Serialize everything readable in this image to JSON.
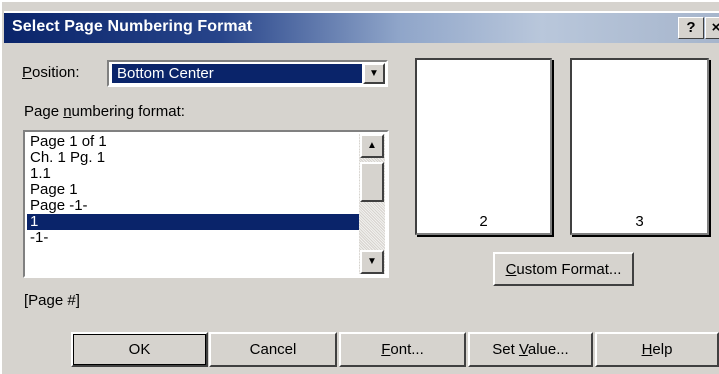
{
  "dialog": {
    "title": "Select Page Numbering Format",
    "help_btn": "?",
    "close_btn": "×"
  },
  "position": {
    "label_accel": "P",
    "label_rest": "osition:",
    "value": "Bottom Center"
  },
  "format": {
    "label_pre": "Page ",
    "label_accel": "n",
    "label_post": "umbering format:",
    "items": [
      "Page 1 of  1",
      "Ch. 1 Pg. 1",
      "1.1",
      "Page 1",
      "Page -1-",
      "1",
      "-1-"
    ],
    "selected_index": 5
  },
  "code_text": "[Page #]",
  "previews": {
    "left_num": "2",
    "right_num": "3"
  },
  "custom_format": {
    "accel": "C",
    "rest": "ustom Format..."
  },
  "buttons": {
    "ok": "OK",
    "cancel": "Cancel",
    "font_accel": "F",
    "font_rest": "ont...",
    "setvalue_pre": "Set ",
    "setvalue_accel": "V",
    "setvalue_post": "alue...",
    "help_accel": "H",
    "help_rest": "elp"
  },
  "icons": {
    "dropdown_arrow": "▼",
    "scroll_up": "▲",
    "scroll_down": "▼"
  },
  "colors": {
    "face": "#d6d3ce",
    "selection": "#0a246a",
    "title_gradient_start": "#0a246a"
  }
}
